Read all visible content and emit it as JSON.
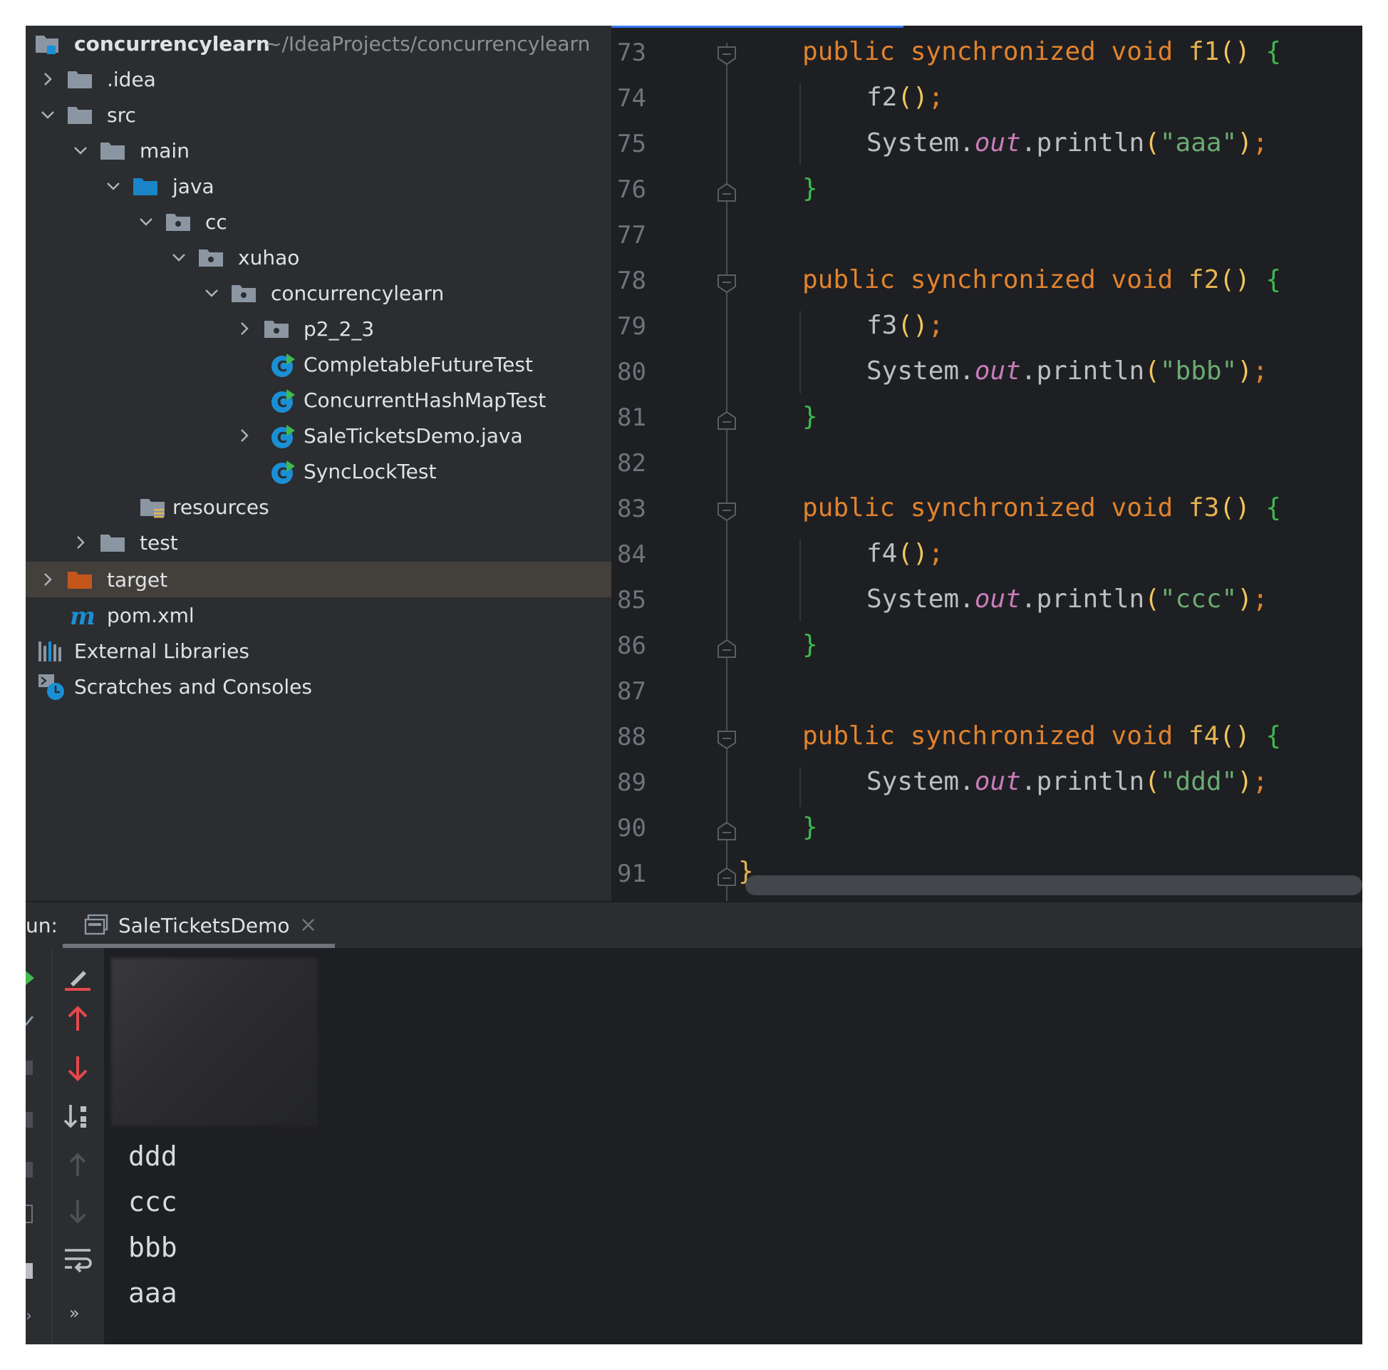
{
  "project_tree": {
    "root": {
      "name": "concurrencylearn",
      "path": "~/IdeaProjects/concurrencylearn"
    },
    "items": [
      {
        "label": ".idea"
      },
      {
        "label": "src"
      },
      {
        "label": "main"
      },
      {
        "label": "java"
      },
      {
        "label": "cc"
      },
      {
        "label": "xuhao"
      },
      {
        "label": "concurrencylearn"
      },
      {
        "label": "p2_2_3"
      },
      {
        "label": "CompletableFutureTest"
      },
      {
        "label": "ConcurrentHashMapTest"
      },
      {
        "label": "SaleTicketsDemo.java"
      },
      {
        "label": "SyncLockTest"
      },
      {
        "label": "resources"
      },
      {
        "label": "test"
      },
      {
        "label": "target"
      },
      {
        "label": "pom.xml"
      },
      {
        "label": "External Libraries"
      },
      {
        "label": "Scratches and Consoles"
      }
    ]
  },
  "editor": {
    "line_numbers": [
      "73",
      "74",
      "75",
      "76",
      "77",
      "78",
      "79",
      "80",
      "81",
      "82",
      "83",
      "84",
      "85",
      "86",
      "87",
      "88",
      "89",
      "90",
      "91"
    ],
    "tokens": {
      "kw_public": "public",
      "kw_synchronized": "synchronized",
      "kw_void": "void",
      "parens": "()",
      "open_brace": "{",
      "close_brace": "}",
      "call_parens": "()",
      "semicolon": ";",
      "system": "System",
      "dot": ".",
      "out": "out",
      "println": "println",
      "open_paren": "(",
      "close_paren": ")"
    },
    "methods": [
      {
        "name": "f1",
        "call": "f2",
        "string": "\"aaa\""
      },
      {
        "name": "f2",
        "call": "f3",
        "string": "\"bbb\""
      },
      {
        "name": "f3",
        "call": "f4",
        "string": "\"ccc\""
      },
      {
        "name": "f4",
        "call": "",
        "string": "\"ddd\""
      }
    ],
    "class_close_brace": "}"
  },
  "run_panel": {
    "label": "un:",
    "tab_title": "SaleTicketsDemo",
    "tab_close": "×",
    "output_lines": [
      "ddd",
      "ccc",
      "bbb",
      "aaa"
    ],
    "more_glyph": "»"
  },
  "colors": {
    "accent": "#3574f0",
    "keyword": "#e0832f",
    "function": "#e6b450",
    "string": "#6aab73",
    "brace": "#3fb950",
    "field": "#c77dbb",
    "folder_blue": "#1a85c8",
    "target_folder": "#c4561c"
  }
}
